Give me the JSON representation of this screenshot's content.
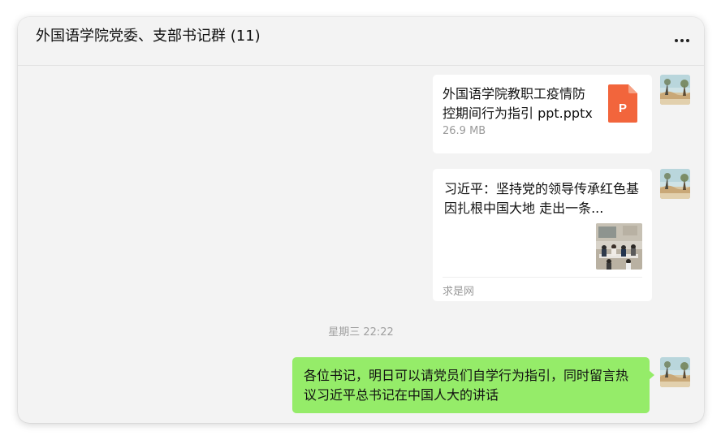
{
  "header": {
    "chat_title": "外国语学院党委、支部书记群 (11)",
    "more_icon": "more-horizontal-icon"
  },
  "messages": {
    "file": {
      "name": "外国语学院教职工疫情防控期间行为指引 ppt.pptx",
      "size": "26.9 MB",
      "icon_letter": "P",
      "icon_color": "#f2653c"
    },
    "article": {
      "title": "习近平：坚持党的领导传承红色基因扎根中国大地 走出一条...",
      "source": "求是网"
    },
    "timestamp": "星期三 22:22",
    "text": "各位书记，明日可以请党员们自学行为指引，同时留言热议习近平总书记在中国人大的讲话"
  },
  "colors": {
    "self_bubble": "#95ec69",
    "window_bg": "#f3f3f3",
    "card_bg": "#ffffff"
  }
}
